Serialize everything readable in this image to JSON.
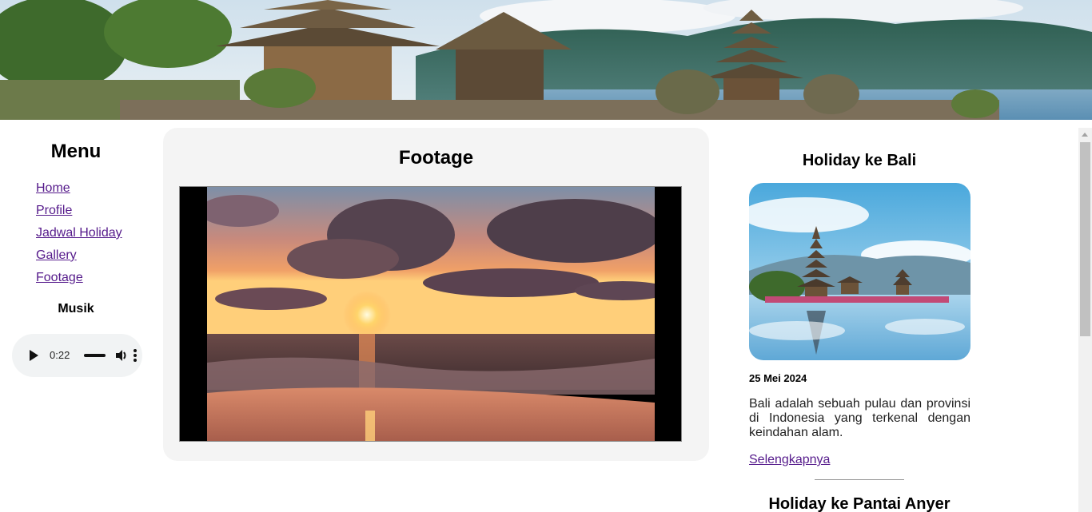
{
  "menu": {
    "title": "Menu",
    "items": [
      {
        "label": "Home"
      },
      {
        "label": "Profile"
      },
      {
        "label": "Jadwal Holiday"
      },
      {
        "label": "Gallery"
      },
      {
        "label": "Footage"
      }
    ],
    "music_title": "Musik",
    "audio": {
      "time": "0:22",
      "icons": [
        "play-icon",
        "volume-icon",
        "more-options-icon"
      ]
    }
  },
  "footage": {
    "title": "Footage"
  },
  "sidebar": {
    "posts": [
      {
        "title": "Holiday ke Bali",
        "date": "25 Mei 2024",
        "text": "Bali adalah sebuah pulau dan provinsi di Indonesia yang terkenal dengan keindahan alam.",
        "link": "Selengkapnya"
      },
      {
        "title": "Holiday ke Pantai Anyer"
      }
    ]
  },
  "colors": {
    "link": "#551a8b",
    "panel_bg": "#f4f4f4",
    "audio_bg": "#f1f3f4"
  }
}
